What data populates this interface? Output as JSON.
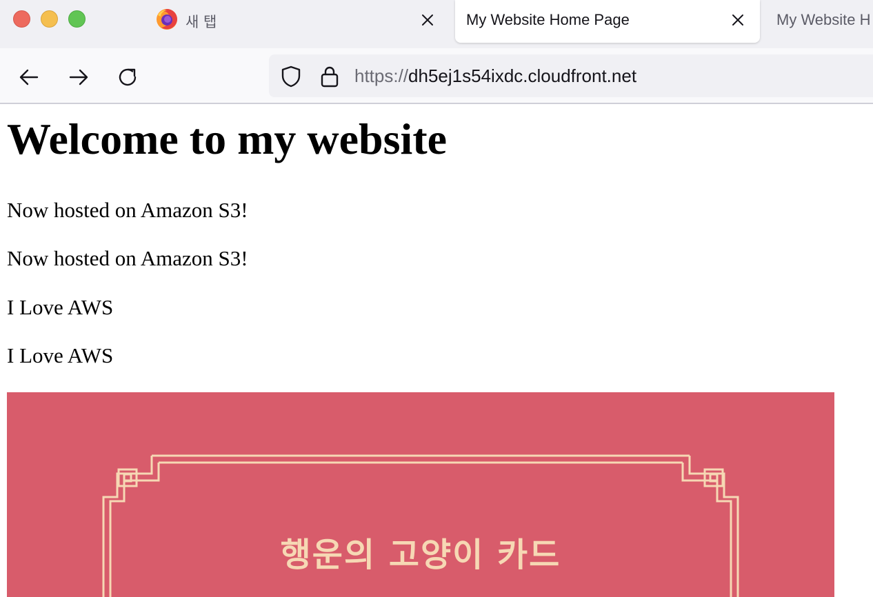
{
  "tabs": [
    {
      "label": "새 탭"
    },
    {
      "label": "My Website Home Page"
    },
    {
      "label": "My Website H"
    }
  ],
  "urlbar": {
    "scheme": "https://",
    "host": "dh5ej1s54ixdc.cloudfront.net"
  },
  "page": {
    "heading": "Welcome to my website",
    "paragraphs": [
      "Now hosted on Amazon S3!",
      "Now hosted on Amazon S3!",
      "I Love AWS",
      "I Love AWS"
    ],
    "image": {
      "title_text": "행운의 고양이 카드",
      "background_color": "#d85c6b",
      "frame_color": "#f6d8b4"
    }
  },
  "icons": {
    "browser_logo": "firefox-icon",
    "tab_close": "close-icon",
    "back": "arrow-left-icon",
    "forward": "arrow-right-icon",
    "reload": "reload-icon",
    "tracking_protection": "shield-icon",
    "secure_connection": "lock-icon"
  }
}
